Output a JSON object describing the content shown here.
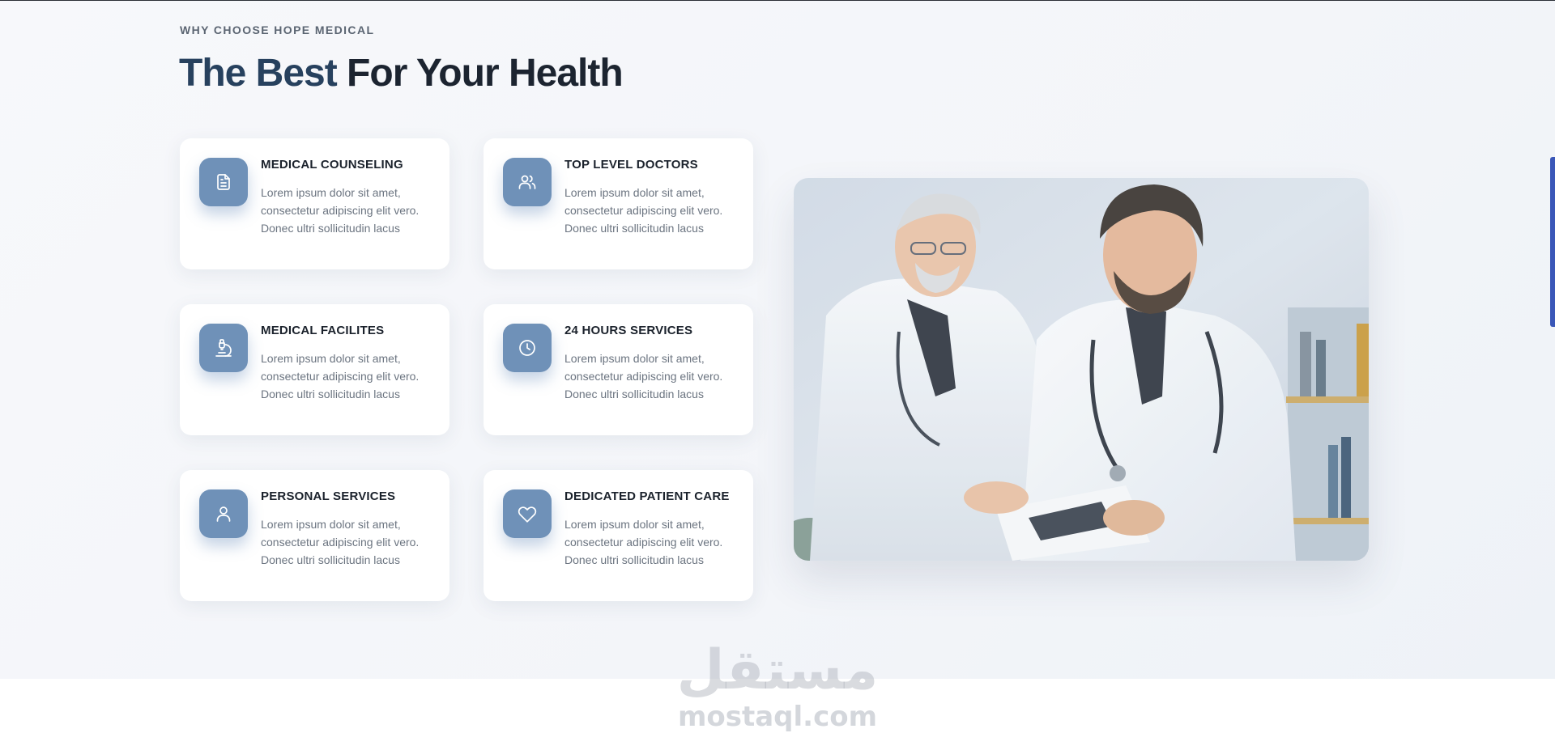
{
  "section": {
    "eyebrow": "WHY CHOOSE HOPE MEDICAL",
    "headline_accent": "The Best",
    "headline_rest": " For Your Health"
  },
  "features": [
    {
      "icon": "document-icon",
      "title": "MEDICAL COUNSELING",
      "text": "Lorem ipsum dolor sit amet, consectetur adipiscing elit vero. Donec ultri sollicitudin lacus"
    },
    {
      "icon": "users-icon",
      "title": "TOP LEVEL DOCTORS",
      "text": "Lorem ipsum dolor sit amet, consectetur adipiscing elit vero. Donec ultri sollicitudin lacus"
    },
    {
      "icon": "microscope-icon",
      "title": "MEDICAL FACILITES",
      "text": "Lorem ipsum dolor sit amet, consectetur adipiscing elit vero. Donec ultri sollicitudin lacus"
    },
    {
      "icon": "clock-icon",
      "title": "24 HOURS SERVICES",
      "text": "Lorem ipsum dolor sit amet, consectetur adipiscing elit vero. Donec ultri sollicitudin lacus"
    },
    {
      "icon": "user-icon",
      "title": "PERSONAL SERVICES",
      "text": "Lorem ipsum dolor sit amet, consectetur adipiscing elit vero. Donec ultri sollicitudin lacus"
    },
    {
      "icon": "heart-icon",
      "title": "DEDICATED PATIENT CARE",
      "text": "Lorem ipsum dolor sit amet, consectetur adipiscing elit vero. Donec ultri sollicitudin lacus"
    }
  ],
  "photo": {
    "subject": "two doctors in white coats looking at a tablet"
  },
  "watermark": {
    "arabic": "مستقل",
    "latin": "mostaql.com"
  },
  "colors": {
    "accent": "#6f91b8",
    "headline_accent": "#27415e",
    "scroll_indicator": "#3a57b8"
  }
}
